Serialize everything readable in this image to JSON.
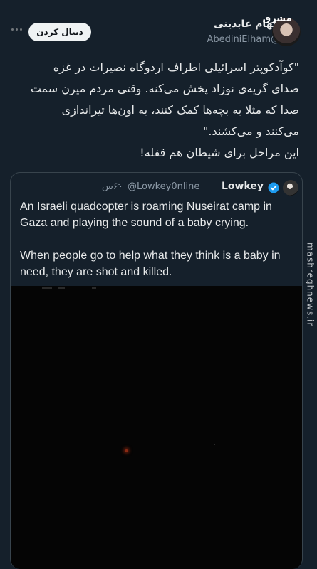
{
  "watermark": "mashreghnews.ir",
  "header": {
    "follow_label": "دنبال کردن",
    "brand_badge": "مشرق"
  },
  "author": {
    "name": "الهام عابدینی",
    "handle": "@AbediniElham"
  },
  "tweet": {
    "text": "\"کوآدکوپتر اسرائیلی اطراف اردوگاه نصیرات در غزه\nصدای گریه‌ی نوزاد پخش می‌کنه. وقتی مردم میرن سمت\nصدا که مثلا به بچه‌ها کمک کنند، به اون‌ها تیراندازی\nمی‌کنند و می‌کشند.\"\nاین مراحل برای شیطان هم قفله!"
  },
  "quote": {
    "name": "Lowkey",
    "handle": "@Lowkey0nline",
    "time": "۶۰س",
    "text": "An Israeli quadcopter is roaming Nuseirat camp in Gaza and playing the sound of a baby crying.\n\nWhen people go to help what they think is a baby in need, they are shot and killed.",
    "verified_color": "#1d9bf0"
  },
  "icons": {
    "more": "more-horizontal-icon",
    "verified": "verified-badge-icon"
  }
}
